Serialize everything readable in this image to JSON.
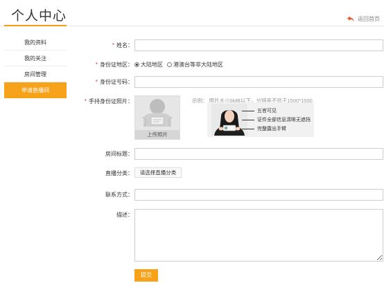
{
  "header": {
    "title": "个人中心",
    "back_label": "返回首页",
    "accent_color": "#f7a21b"
  },
  "sidebar": {
    "items": [
      {
        "label": "我的资料",
        "active": false
      },
      {
        "label": "我的关注",
        "active": false
      },
      {
        "label": "房间管理",
        "active": false
      },
      {
        "label": "申请直播间",
        "active": true
      }
    ]
  },
  "form": {
    "required_mark": "*",
    "name": {
      "label": "姓名：",
      "value": ""
    },
    "region": {
      "label": "身份证地区：",
      "options": [
        {
          "label": "大陆地区",
          "selected": true
        },
        {
          "label": "港澳台等非大陆地区",
          "selected": false
        }
      ]
    },
    "id_number": {
      "label": "身份证号码：",
      "value": ""
    },
    "id_photo": {
      "label": "手持身份证照片：",
      "upload_label": "上传照片",
      "example_text": "示例：  照片大小5MB以下，分辨率不低于1500*1500",
      "example_notes": [
        "五官可见",
        "证件全部信息清晰无遮挡",
        "完整露出手臂"
      ]
    },
    "room_title": {
      "label": "房间标题：",
      "value": ""
    },
    "category": {
      "label": "直播分类：",
      "button_label": "请选择直播分类"
    },
    "contact": {
      "label": "联系方式：",
      "value": ""
    },
    "description": {
      "label": "描述：",
      "value": ""
    },
    "submit_label": "提交"
  }
}
